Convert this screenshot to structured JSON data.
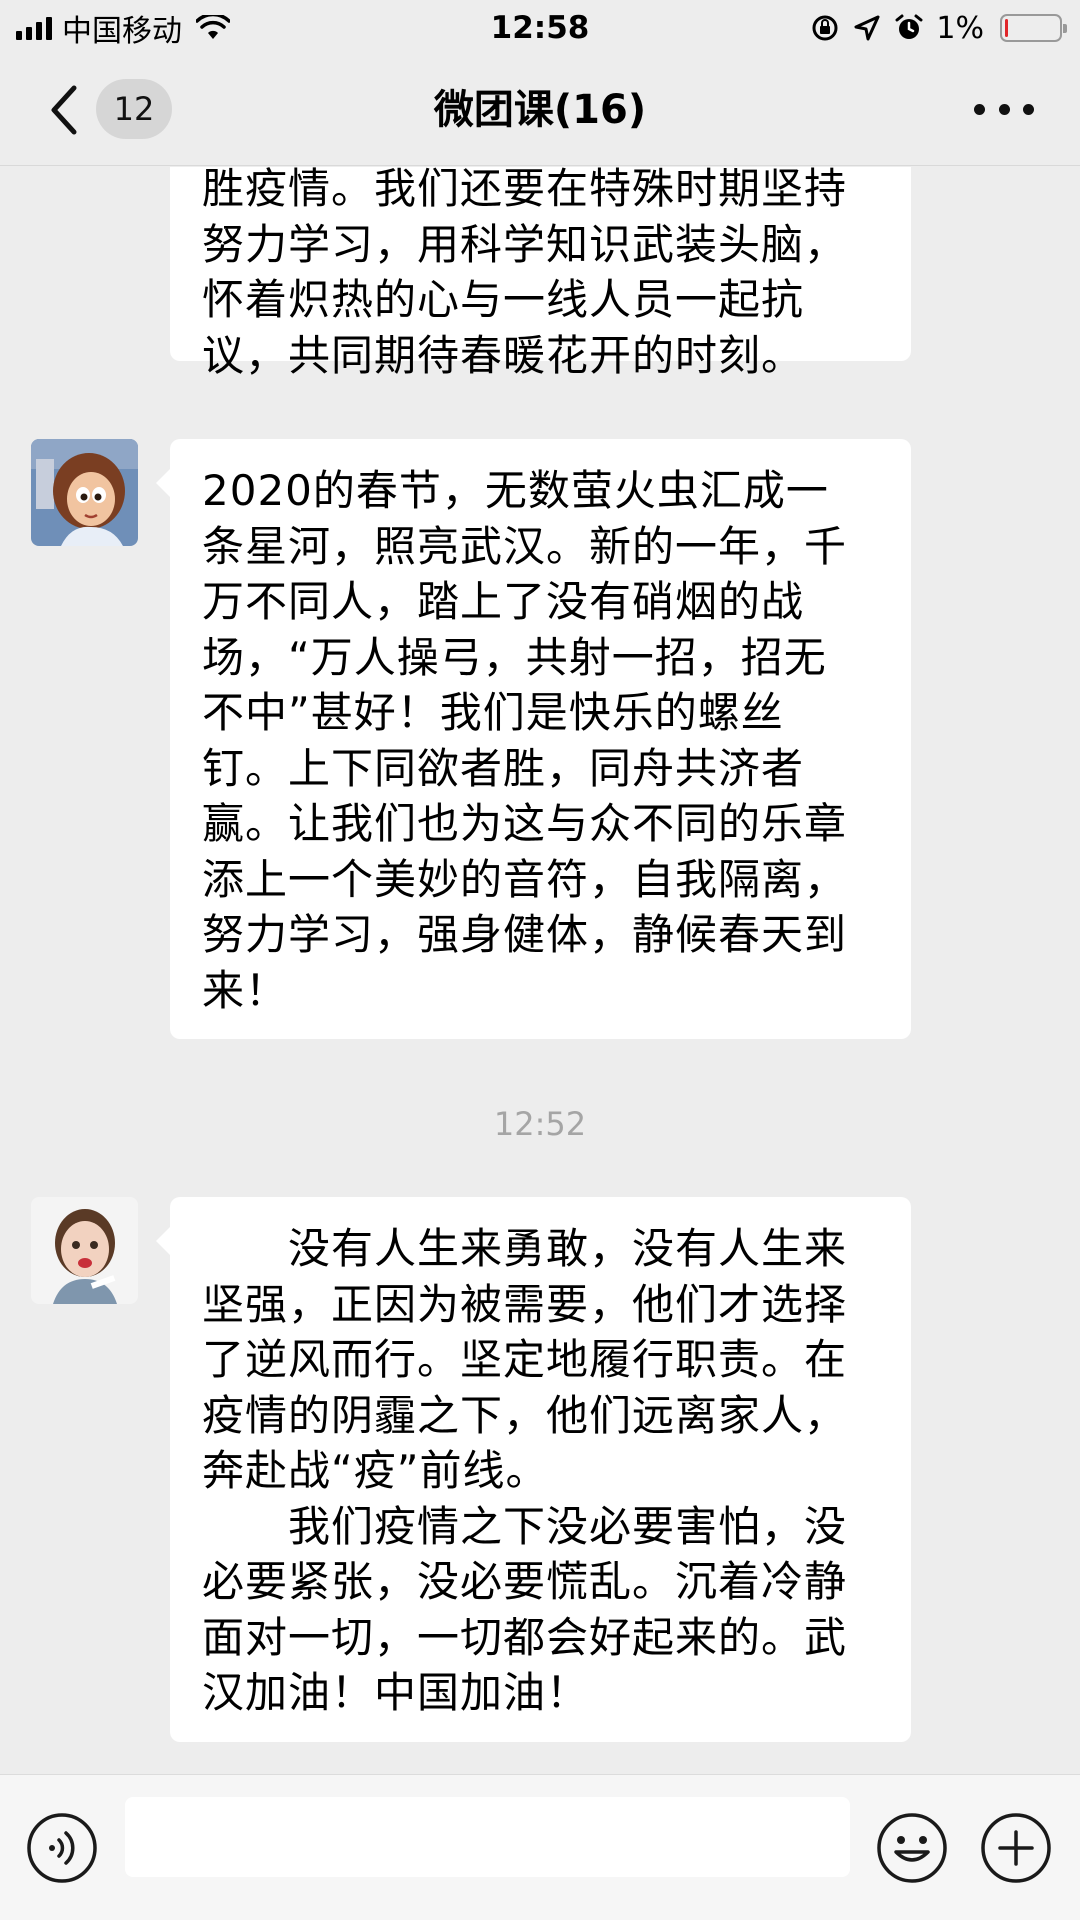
{
  "status_bar": {
    "carrier": "中国移动",
    "time": "12:58",
    "battery_percent": "1%",
    "battery_level": 0.04,
    "icons": [
      "signal-icon",
      "wifi-icon",
      "orientation-lock-icon",
      "location-icon",
      "alarm-icon",
      "battery-icon"
    ]
  },
  "nav": {
    "unread_count": "12",
    "title": "微团课(16)",
    "icons": [
      "back-arrow-icon",
      "more-icon"
    ]
  },
  "messages": [
    {
      "text": "胜疫情。我们还要在特殊时期坚持\n努力学习，用科学知识武装头脑，\n怀着炽热的心与一线人员一起抗\n议，共同期待春暖花开的时刻。",
      "has_avatar": false
    },
    {
      "text": "2020的春节，无数萤火虫汇成一\n条星河，照亮武汉。新的一年，千\n万不同人，踏上了没有硝烟的战\n场，“万人操弓，共射一招，招无\n不中”甚好！我们是快乐的螺丝\n钉。上下同欲者胜，同舟共济者\n赢。让我们也为这与众不同的乐章\n添上一个美妙的音符，自我隔离，\n努力学习，强身健体，静候春天到\n来！",
      "has_avatar": true,
      "avatar": "cartoon-girl-avatar"
    },
    {
      "text": "　　没有人生来勇敢，没有人生来\n坚强，正因为被需要，他们才选择\n了逆风而行。坚定地履行职责。在\n疫情的阴霾之下，他们远离家人，\n奔赴战“疫”前线。\n　　我们疫情之下没必要害怕，没\n必要紧张，没必要慌乱。沉着冷静\n面对一切，一切都会好起来的。武\n汉加油！中国加油！",
      "has_avatar": true,
      "avatar": "child-photo-avatar"
    }
  ],
  "timestamp": "12:52",
  "input_bar": {
    "input_value": "",
    "icons": [
      "voice-icon",
      "emoji-icon",
      "plus-icon"
    ]
  },
  "colors": {
    "background": "#ededed",
    "bubble": "#ffffff",
    "timestamp": "#a5a5a5",
    "battery_low": "#e0262a"
  }
}
